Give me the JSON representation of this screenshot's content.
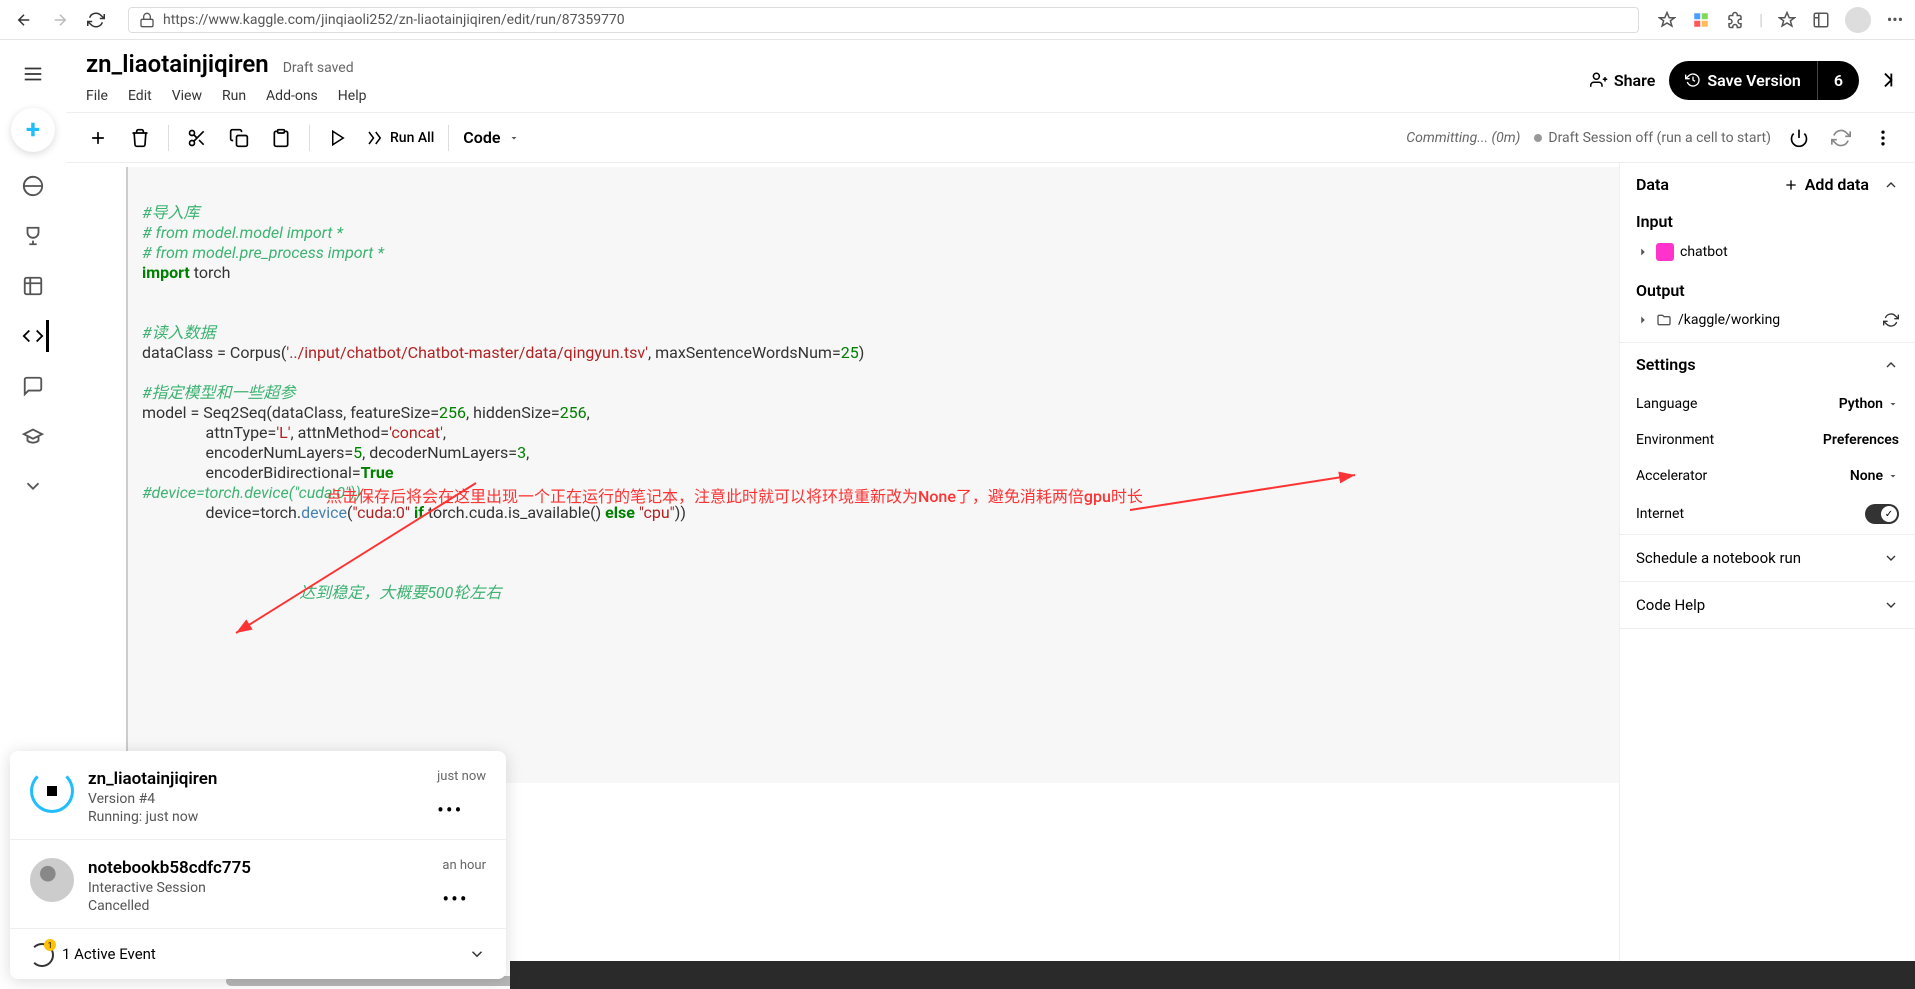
{
  "browser": {
    "url": "https://www.kaggle.com/jinqiaoli252/zn-liaotainjiqiren/edit/run/87359770"
  },
  "header": {
    "title": "zn_liaotainjiqiren",
    "draft_status": "Draft saved",
    "menu": {
      "file": "File",
      "edit": "Edit",
      "view": "View",
      "run": "Run",
      "addons": "Add-ons",
      "help": "Help"
    },
    "share": "Share",
    "save_version": "Save Version",
    "version_count": "6"
  },
  "toolbar": {
    "run_all": "Run All",
    "code_dropdown": "Code",
    "committing": "Committing... (0m)",
    "session_status": "Draft Session off (run a cell to start)"
  },
  "code": {
    "l1": "#导入库",
    "l2": "# from model.model import *",
    "l3": "# from model.pre_process import *",
    "l4a": "import",
    "l4b": " torch",
    "l5": "#读入数据",
    "l6a": "dataClass = Corpus(",
    "l6b": "'../input/chatbot/Chatbot-master/data/qingyun.tsv'",
    "l6c": ", maxSentenceWordsNum=",
    "l6d": "25",
    "l6e": ")",
    "l7": "#指定模型和一些超参",
    "l8a": "model = Seq2Seq(dataClass, featureSize=",
    "l8b": "256",
    "l8c": ", hiddenSize=",
    "l8d": "256",
    "l8e": ",",
    "l9a": "                attnType=",
    "l9b": "'L'",
    "l9c": ", attnMethod=",
    "l9d": "'concat'",
    "l9e": ",",
    "l10a": "                encoderNumLayers=",
    "l10b": "5",
    "l10c": ", decoderNumLayers=",
    "l10d": "3",
    "l10e": ",",
    "l11a": "                encoderBidirectional=",
    "l11b": "True",
    "l11c": ",",
    "l12": "#device=torch.device(\"cuda:0\"))",
    "l13a": "                device=torch.",
    "l13b": "device",
    "l13c": "(",
    "l13d": "\"cuda:0\"",
    "l13e": " ",
    "l13f": "if",
    "l13g": " torch.cuda.is_available() ",
    "l13h": "else",
    "l13i": " ",
    "l13j": "\"cpu\"",
    "l13k": "))",
    "l14": "达到稳定，大概要500轮左右"
  },
  "annotation": {
    "text": "点击保存后将会在这里出现一个正在运行的笔记本，注意此时就可以将环境重新改为None了，避免消耗两倍gpu时长"
  },
  "right_panel": {
    "data_title": "Data",
    "add_data": "Add data",
    "input_title": "Input",
    "input_item": "chatbot",
    "output_title": "Output",
    "output_item": "/kaggle/working",
    "settings_title": "Settings",
    "language_label": "Language",
    "language_value": "Python",
    "environment_label": "Environment",
    "environment_value": "Preferences",
    "accelerator_label": "Accelerator",
    "accelerator_value": "None",
    "internet_label": "Internet",
    "schedule_label": "Schedule a notebook run",
    "codehelp_label": "Code Help"
  },
  "popup": {
    "items": [
      {
        "title": "zn_liaotainjiqiren",
        "sub1": "Version #4",
        "sub2": "Running: just now",
        "time": "just now"
      },
      {
        "title": "notebookb58cdfc775",
        "sub1": "Interactive Session",
        "sub2": "Cancelled",
        "time": "an hour"
      }
    ],
    "footer": "1 Active Event"
  }
}
